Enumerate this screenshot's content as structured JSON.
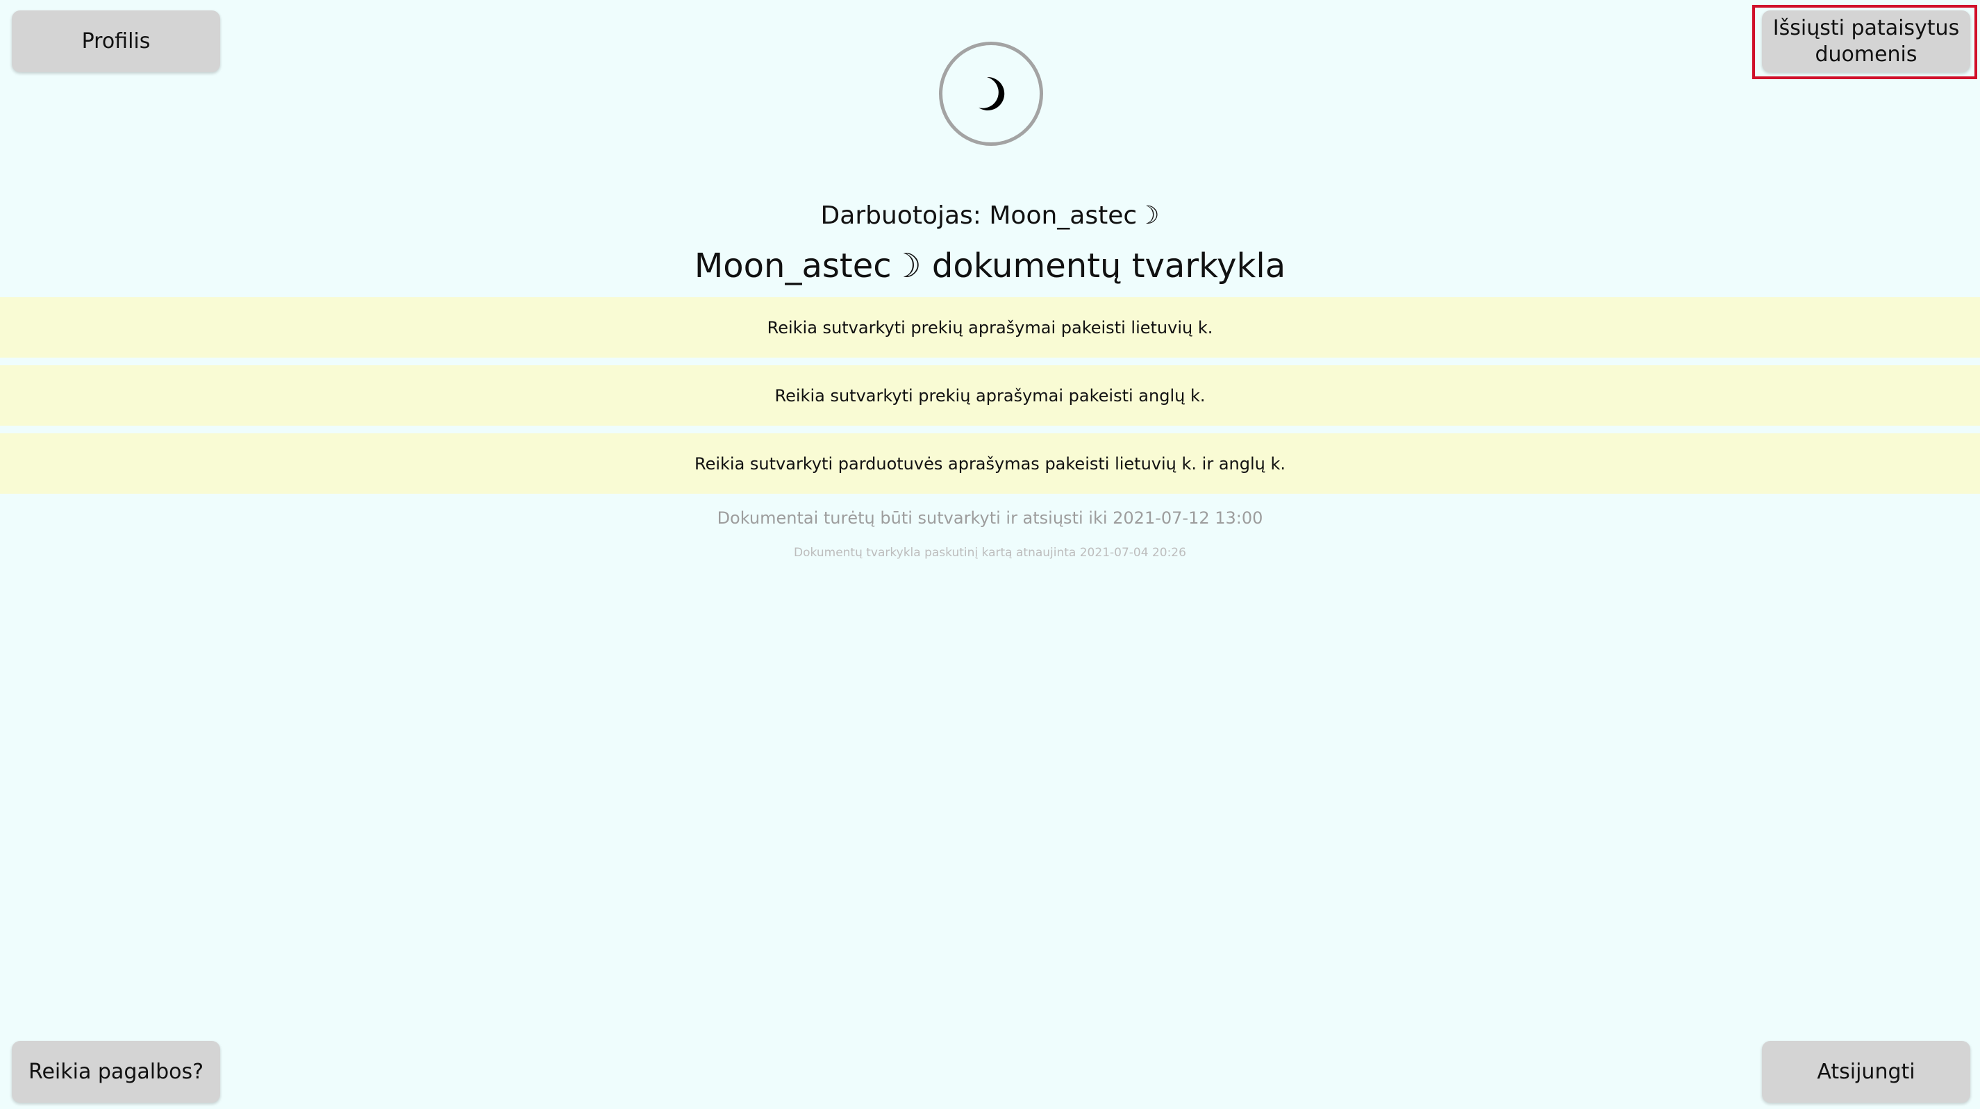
{
  "buttons": {
    "profile": "Profilis",
    "send_fixed": "Išsiųsti pataisytus duomenis",
    "help": "Reikia pagalbos?",
    "logout": "Atsijungti"
  },
  "avatar": {
    "icon": "moon-icon"
  },
  "header": {
    "worker": "Darbuotojas: Moon_astec☽",
    "title": "Moon_astec☽ dokumentų tvarkykla"
  },
  "tasks": [
    "Reikia sutvarkyti prekių aprašymai pakeisti lietuvių k.",
    "Reikia sutvarkyti prekių aprašymai pakeisti anglų k.",
    "Reikia sutvarkyti parduotuvės aprašymas pakeisti lietuvių k. ir anglų k."
  ],
  "footer_notes": {
    "deadline": "Dokumentai turėtų būti sutvarkyti ir atsiųsti iki 2021-07-12 13:00",
    "updated": "Dokumentų tvarkykla paskutinį kartą atnaujinta 2021-07-04 20:26"
  },
  "colors": {
    "background": "#effdfd",
    "button": "#d4d4d4",
    "task_row": "#f9fbd4",
    "highlight_border": "#d0112b"
  }
}
